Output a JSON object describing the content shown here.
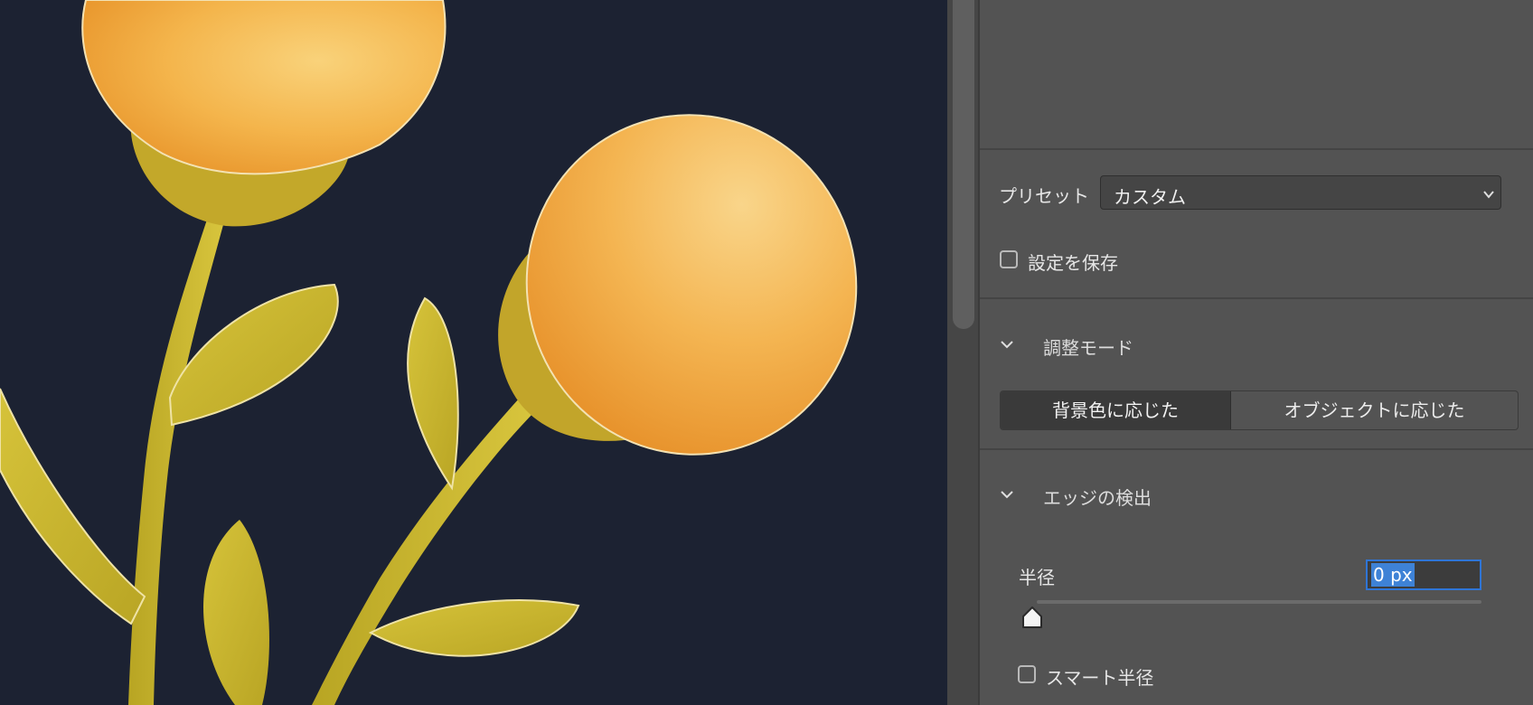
{
  "panel": {
    "preset_label": "プリセット",
    "preset_value": "カスタム",
    "save_settings_label": "設定を保存",
    "adjust_mode": {
      "title": "調整モード",
      "options": [
        "背景色に応じた",
        "オブジェクトに応じた"
      ],
      "selected_index": 0
    },
    "edge_detection": {
      "title": "エッジの検出",
      "radius_label": "半径",
      "radius_value": "0 px",
      "radius_slider_fraction": 0,
      "smart_radius_label": "スマート半径"
    }
  },
  "colors": {
    "canvas_background": "#1c2232",
    "flower_orange": "#f2b24a",
    "stem_yellow": "#c9b72d",
    "panel_background": "#535353",
    "accent_blue": "#2f75d6"
  }
}
